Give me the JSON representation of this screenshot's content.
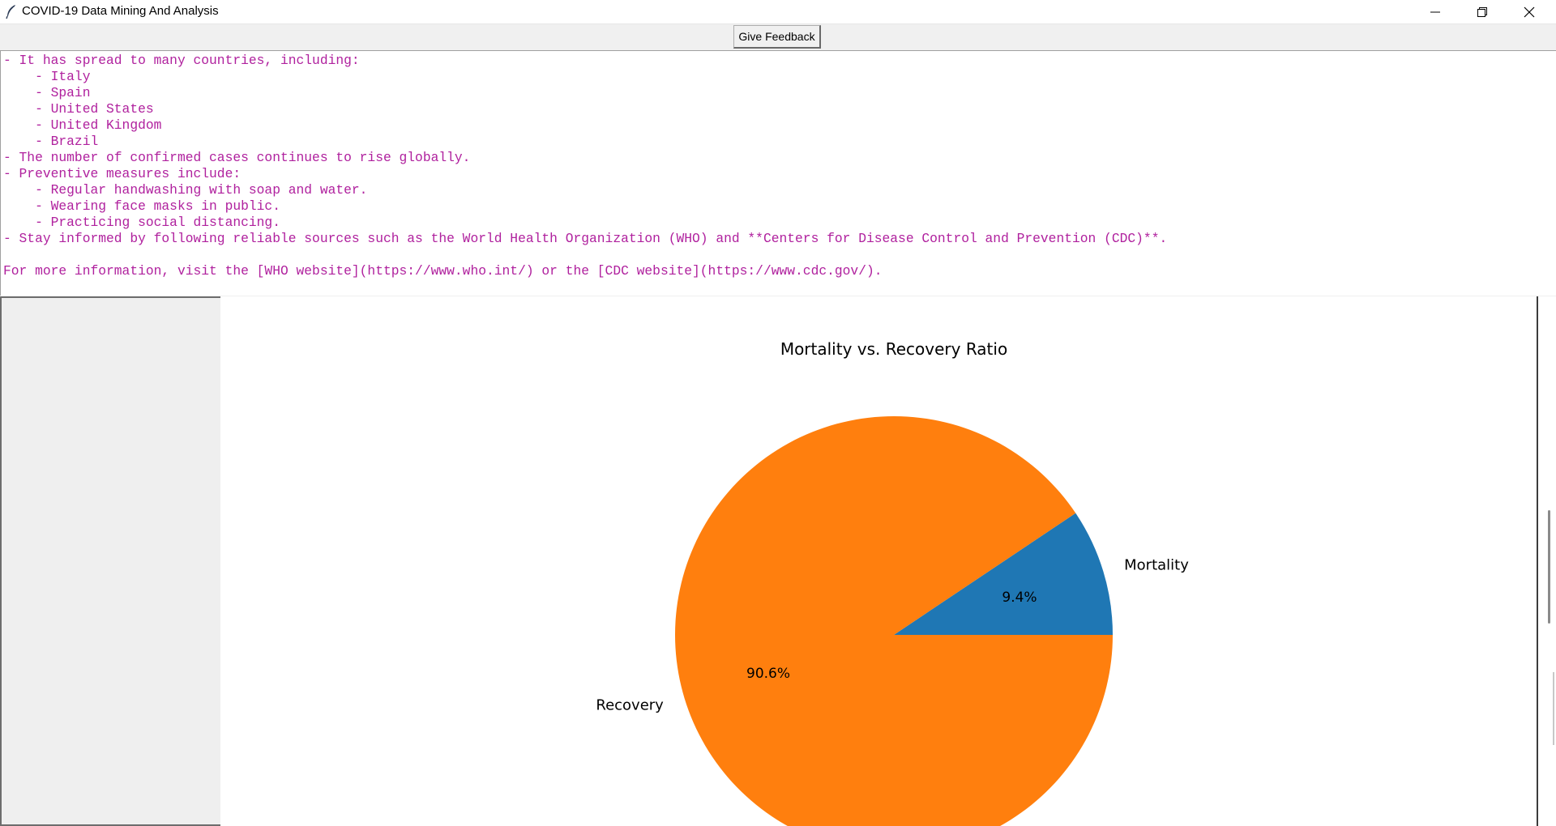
{
  "window": {
    "title": "COVID-19 Data Mining And Analysis",
    "icon": "feather-icon",
    "controls": [
      "minimize-icon",
      "restore-icon",
      "close-icon"
    ]
  },
  "toolbar": {
    "feedback_label": "Give Feedback"
  },
  "text_area": {
    "lines": [
      "- It has spread to many countries, including:",
      "    - Italy",
      "    - Spain",
      "    - United States",
      "    - United Kingdom",
      "    - Brazil",
      "- The number of confirmed cases continues to rise globally.",
      "- Preventive measures include:",
      "    - Regular handwashing with soap and water.",
      "    - Wearing face masks in public.",
      "    - Practicing social distancing.",
      "- Stay informed by following reliable sources such as the World Health Organization (WHO) and **Centers for Disease Control and Prevention (CDC)**.",
      "",
      "For more information, visit the [WHO website](https://www.who.int/) or the [CDC website](https://www.cdc.gov/)."
    ],
    "text_color": "#b0219e"
  },
  "chart_data": {
    "type": "pie",
    "title": "Mortality vs. Recovery Ratio",
    "categories": [
      "Mortality",
      "Recovery"
    ],
    "values": [
      9.4,
      90.6
    ],
    "value_labels": [
      "9.4%",
      "90.6%"
    ],
    "colors": [
      "#1f77b4",
      "#ff7f0e"
    ],
    "start_angle": 0,
    "direction": "counterclockwise"
  }
}
